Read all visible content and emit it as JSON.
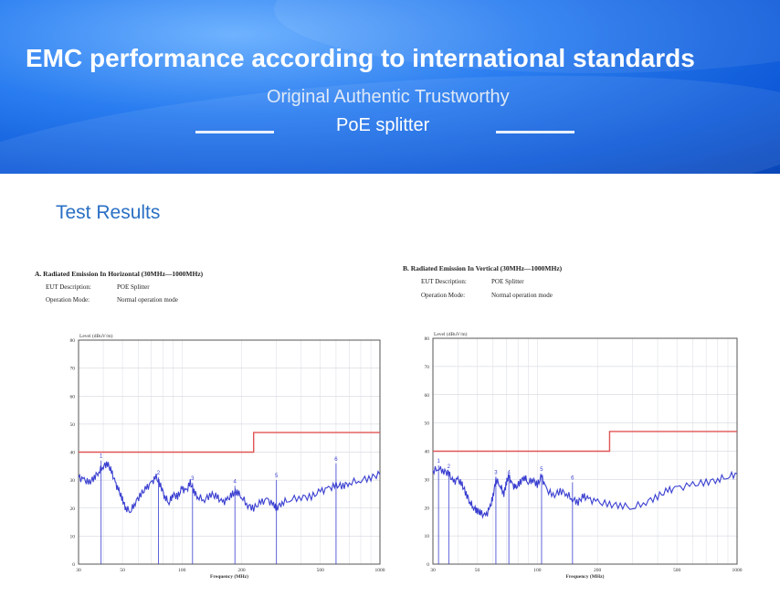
{
  "banner": {
    "title": "EMC performance according to international standards",
    "subtitle": "Original Authentic Trustworthy",
    "product": "PoE splitter"
  },
  "section_title": "Test Results",
  "colors": {
    "banner": "#1e6fe6",
    "limit_line": "#e05555",
    "trace": "#3a3fd0",
    "section_title": "#2a6fc4"
  },
  "chart_data": [
    {
      "type": "line",
      "title": "A. Radiated Emission In Horizontal (30MHz—1000MHz)",
      "eut_label": "EUT Description:",
      "eut_value": "POE Splitter",
      "mode_label": "Operation Mode:",
      "mode_value": "Normal operation mode",
      "ylabel": "Level (dBuV/m)",
      "xlabel": "Frequency (MHz)",
      "xscale": "log",
      "xlim": [
        30,
        1000
      ],
      "ylim": [
        0,
        80
      ],
      "yticks": [
        0,
        10,
        20,
        30,
        40,
        50,
        60,
        70,
        80
      ],
      "xticks": [
        30,
        50,
        100,
        200,
        500,
        1000
      ],
      "grid": true,
      "limit_line": {
        "x": [
          30,
          230,
          230,
          1000
        ],
        "y": [
          40,
          40,
          47,
          47
        ]
      },
      "trace": {
        "x": [
          30,
          32,
          34,
          36,
          38,
          40,
          42,
          44,
          46,
          48,
          50,
          52,
          55,
          58,
          62,
          66,
          70,
          74,
          78,
          82,
          86,
          90,
          95,
          100,
          105,
          110,
          115,
          120,
          130,
          140,
          150,
          160,
          170,
          180,
          190,
          200,
          215,
          230,
          250,
          270,
          290,
          300,
          320,
          350,
          400,
          450,
          500,
          550,
          600,
          650,
          700,
          800,
          900,
          1000
        ],
        "y": [
          31,
          30,
          29,
          31,
          33,
          35,
          36,
          33,
          29,
          26,
          23,
          20,
          19,
          22,
          25,
          27,
          29,
          31,
          28,
          24,
          22,
          25,
          24,
          27,
          26,
          29,
          26,
          24,
          23,
          25,
          24,
          22,
          23,
          25,
          26,
          24,
          21,
          20,
          22,
          23,
          21,
          20,
          22,
          23,
          24,
          24,
          26,
          27,
          28,
          28,
          29,
          30,
          31,
          32
        ]
      },
      "markers": [
        {
          "n": "1",
          "x": 39,
          "y": 37
        },
        {
          "n": "2",
          "x": 76,
          "y": 31
        },
        {
          "n": "3",
          "x": 113,
          "y": 29
        },
        {
          "n": "4",
          "x": 185,
          "y": 28
        },
        {
          "n": "5",
          "x": 300,
          "y": 30
        },
        {
          "n": "6",
          "x": 600,
          "y": 36
        }
      ]
    },
    {
      "type": "line",
      "title": "B. Radiated Emission In Vertical (30MHz—1000MHz)",
      "eut_label": "EUT Description:",
      "eut_value": "POE Splitter",
      "mode_label": "Operation Mode:",
      "mode_value": "Normal operation mode",
      "ylabel": "Level (dBuV/m)",
      "xlabel": "Frequency (MHz)",
      "xscale": "log",
      "xlim": [
        30,
        1000
      ],
      "ylim": [
        0,
        80
      ],
      "yticks": [
        0,
        10,
        20,
        30,
        40,
        50,
        60,
        70,
        80
      ],
      "xticks": [
        30,
        50,
        100,
        200,
        500,
        1000
      ],
      "grid": true,
      "limit_line": {
        "x": [
          30,
          230,
          230,
          1000
        ],
        "y": [
          40,
          40,
          47,
          47
        ]
      },
      "trace": {
        "x": [
          30,
          32,
          34,
          36,
          38,
          40,
          42,
          44,
          46,
          48,
          50,
          52,
          55,
          58,
          60,
          62,
          65,
          68,
          70,
          72,
          75,
          78,
          82,
          86,
          90,
          95,
          100,
          105,
          110,
          120,
          130,
          140,
          150,
          160,
          170,
          180,
          200,
          230,
          260,
          300,
          350,
          400,
          450,
          500,
          600,
          700,
          800,
          900,
          1000
        ],
        "y": [
          33,
          34,
          33,
          32,
          29,
          30,
          28,
          25,
          22,
          20,
          19,
          18,
          17,
          20,
          24,
          30,
          28,
          25,
          29,
          31,
          28,
          27,
          29,
          31,
          29,
          30,
          28,
          31,
          27,
          24,
          26,
          25,
          23,
          22,
          24,
          23,
          22,
          21,
          21,
          20,
          22,
          24,
          26,
          27,
          28,
          29,
          30,
          31,
          32
        ]
      },
      "markers": [
        {
          "n": "1",
          "x": 32,
          "y": 35
        },
        {
          "n": "2",
          "x": 36,
          "y": 33
        },
        {
          "n": "3",
          "x": 62,
          "y": 31
        },
        {
          "n": "4",
          "x": 72,
          "y": 31
        },
        {
          "n": "5",
          "x": 105,
          "y": 32
        },
        {
          "n": "6",
          "x": 150,
          "y": 29
        }
      ]
    }
  ]
}
